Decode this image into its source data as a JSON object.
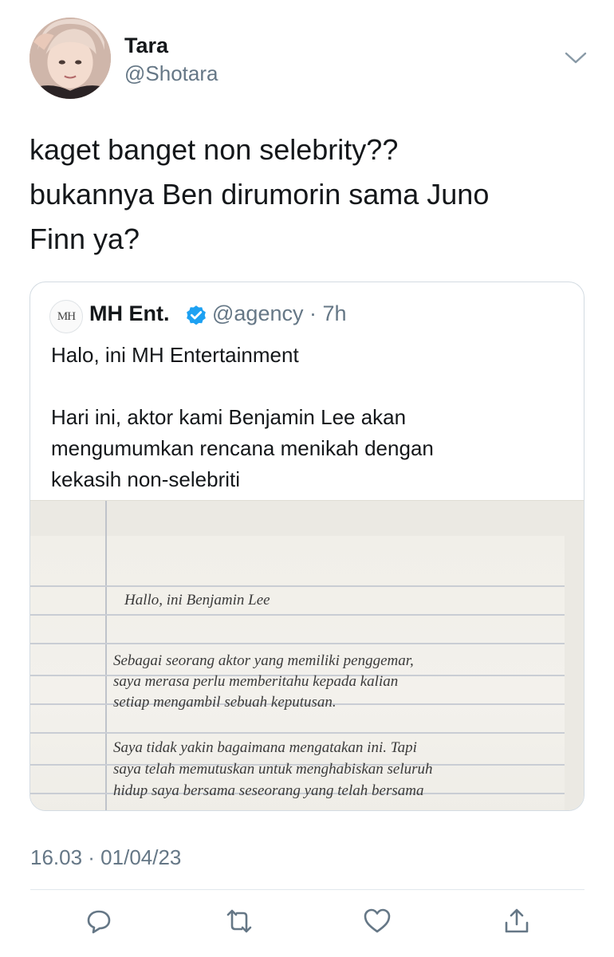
{
  "tweet": {
    "author": {
      "name": "Tara",
      "handle": "@Shotara"
    },
    "text_lines": [
      "kaget banget non selebrity??",
      "bukannya Ben dirumorin sama Juno",
      "Finn ya?"
    ],
    "timestamp": "16.03 · 01/04/23"
  },
  "quoted": {
    "avatar_text": "MH",
    "name": "MH Ent.",
    "handle_time": "@agency · 7h",
    "text_lines": [
      "Halo, ini MH Entertainment",
      "",
      "Hari ini, aktor kami Benjamin Lee akan",
      "mengumumkan rencana menikah dengan",
      "kekasih non-selebriti"
    ],
    "image_lines": [
      "Hallo, ini Benjamin Lee",
      "Sebagai seorang aktor yang memiliki penggemar,",
      "saya merasa perlu memberitahu kepada kalian",
      "setiap mengambil sebuah keputusan.",
      "Saya tidak yakin bagaimana mengatakan ini. Tapi",
      "saya telah memutuskan untuk menghabiskan seluruh",
      "hidup saya bersama seseorang yang telah bersama"
    ]
  },
  "icons": {
    "more": "chevron-down-icon",
    "reply": "reply-icon",
    "retweet": "retweet-icon",
    "like": "heart-icon",
    "share": "share-icon",
    "verified": "verified-badge-icon"
  },
  "colors": {
    "text": "#14171a",
    "secondary": "#657786",
    "verified": "#1da1f2"
  }
}
